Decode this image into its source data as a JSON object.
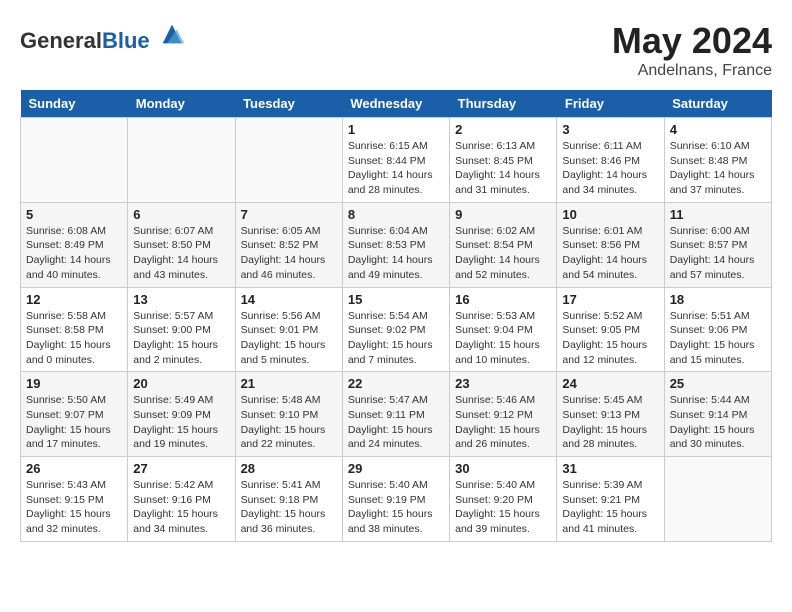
{
  "header": {
    "logo_general": "General",
    "logo_blue": "Blue",
    "month_year": "May 2024",
    "location": "Andelnans, France"
  },
  "weekdays": [
    "Sunday",
    "Monday",
    "Tuesday",
    "Wednesday",
    "Thursday",
    "Friday",
    "Saturday"
  ],
  "weeks": [
    [
      {
        "day": "",
        "sunrise": "",
        "sunset": "",
        "daylight": ""
      },
      {
        "day": "",
        "sunrise": "",
        "sunset": "",
        "daylight": ""
      },
      {
        "day": "",
        "sunrise": "",
        "sunset": "",
        "daylight": ""
      },
      {
        "day": "1",
        "sunrise": "Sunrise: 6:15 AM",
        "sunset": "Sunset: 8:44 PM",
        "daylight": "Daylight: 14 hours and 28 minutes."
      },
      {
        "day": "2",
        "sunrise": "Sunrise: 6:13 AM",
        "sunset": "Sunset: 8:45 PM",
        "daylight": "Daylight: 14 hours and 31 minutes."
      },
      {
        "day": "3",
        "sunrise": "Sunrise: 6:11 AM",
        "sunset": "Sunset: 8:46 PM",
        "daylight": "Daylight: 14 hours and 34 minutes."
      },
      {
        "day": "4",
        "sunrise": "Sunrise: 6:10 AM",
        "sunset": "Sunset: 8:48 PM",
        "daylight": "Daylight: 14 hours and 37 minutes."
      }
    ],
    [
      {
        "day": "5",
        "sunrise": "Sunrise: 6:08 AM",
        "sunset": "Sunset: 8:49 PM",
        "daylight": "Daylight: 14 hours and 40 minutes."
      },
      {
        "day": "6",
        "sunrise": "Sunrise: 6:07 AM",
        "sunset": "Sunset: 8:50 PM",
        "daylight": "Daylight: 14 hours and 43 minutes."
      },
      {
        "day": "7",
        "sunrise": "Sunrise: 6:05 AM",
        "sunset": "Sunset: 8:52 PM",
        "daylight": "Daylight: 14 hours and 46 minutes."
      },
      {
        "day": "8",
        "sunrise": "Sunrise: 6:04 AM",
        "sunset": "Sunset: 8:53 PM",
        "daylight": "Daylight: 14 hours and 49 minutes."
      },
      {
        "day": "9",
        "sunrise": "Sunrise: 6:02 AM",
        "sunset": "Sunset: 8:54 PM",
        "daylight": "Daylight: 14 hours and 52 minutes."
      },
      {
        "day": "10",
        "sunrise": "Sunrise: 6:01 AM",
        "sunset": "Sunset: 8:56 PM",
        "daylight": "Daylight: 14 hours and 54 minutes."
      },
      {
        "day": "11",
        "sunrise": "Sunrise: 6:00 AM",
        "sunset": "Sunset: 8:57 PM",
        "daylight": "Daylight: 14 hours and 57 minutes."
      }
    ],
    [
      {
        "day": "12",
        "sunrise": "Sunrise: 5:58 AM",
        "sunset": "Sunset: 8:58 PM",
        "daylight": "Daylight: 15 hours and 0 minutes."
      },
      {
        "day": "13",
        "sunrise": "Sunrise: 5:57 AM",
        "sunset": "Sunset: 9:00 PM",
        "daylight": "Daylight: 15 hours and 2 minutes."
      },
      {
        "day": "14",
        "sunrise": "Sunrise: 5:56 AM",
        "sunset": "Sunset: 9:01 PM",
        "daylight": "Daylight: 15 hours and 5 minutes."
      },
      {
        "day": "15",
        "sunrise": "Sunrise: 5:54 AM",
        "sunset": "Sunset: 9:02 PM",
        "daylight": "Daylight: 15 hours and 7 minutes."
      },
      {
        "day": "16",
        "sunrise": "Sunrise: 5:53 AM",
        "sunset": "Sunset: 9:04 PM",
        "daylight": "Daylight: 15 hours and 10 minutes."
      },
      {
        "day": "17",
        "sunrise": "Sunrise: 5:52 AM",
        "sunset": "Sunset: 9:05 PM",
        "daylight": "Daylight: 15 hours and 12 minutes."
      },
      {
        "day": "18",
        "sunrise": "Sunrise: 5:51 AM",
        "sunset": "Sunset: 9:06 PM",
        "daylight": "Daylight: 15 hours and 15 minutes."
      }
    ],
    [
      {
        "day": "19",
        "sunrise": "Sunrise: 5:50 AM",
        "sunset": "Sunset: 9:07 PM",
        "daylight": "Daylight: 15 hours and 17 minutes."
      },
      {
        "day": "20",
        "sunrise": "Sunrise: 5:49 AM",
        "sunset": "Sunset: 9:09 PM",
        "daylight": "Daylight: 15 hours and 19 minutes."
      },
      {
        "day": "21",
        "sunrise": "Sunrise: 5:48 AM",
        "sunset": "Sunset: 9:10 PM",
        "daylight": "Daylight: 15 hours and 22 minutes."
      },
      {
        "day": "22",
        "sunrise": "Sunrise: 5:47 AM",
        "sunset": "Sunset: 9:11 PM",
        "daylight": "Daylight: 15 hours and 24 minutes."
      },
      {
        "day": "23",
        "sunrise": "Sunrise: 5:46 AM",
        "sunset": "Sunset: 9:12 PM",
        "daylight": "Daylight: 15 hours and 26 minutes."
      },
      {
        "day": "24",
        "sunrise": "Sunrise: 5:45 AM",
        "sunset": "Sunset: 9:13 PM",
        "daylight": "Daylight: 15 hours and 28 minutes."
      },
      {
        "day": "25",
        "sunrise": "Sunrise: 5:44 AM",
        "sunset": "Sunset: 9:14 PM",
        "daylight": "Daylight: 15 hours and 30 minutes."
      }
    ],
    [
      {
        "day": "26",
        "sunrise": "Sunrise: 5:43 AM",
        "sunset": "Sunset: 9:15 PM",
        "daylight": "Daylight: 15 hours and 32 minutes."
      },
      {
        "day": "27",
        "sunrise": "Sunrise: 5:42 AM",
        "sunset": "Sunset: 9:16 PM",
        "daylight": "Daylight: 15 hours and 34 minutes."
      },
      {
        "day": "28",
        "sunrise": "Sunrise: 5:41 AM",
        "sunset": "Sunset: 9:18 PM",
        "daylight": "Daylight: 15 hours and 36 minutes."
      },
      {
        "day": "29",
        "sunrise": "Sunrise: 5:40 AM",
        "sunset": "Sunset: 9:19 PM",
        "daylight": "Daylight: 15 hours and 38 minutes."
      },
      {
        "day": "30",
        "sunrise": "Sunrise: 5:40 AM",
        "sunset": "Sunset: 9:20 PM",
        "daylight": "Daylight: 15 hours and 39 minutes."
      },
      {
        "day": "31",
        "sunrise": "Sunrise: 5:39 AM",
        "sunset": "Sunset: 9:21 PM",
        "daylight": "Daylight: 15 hours and 41 minutes."
      },
      {
        "day": "",
        "sunrise": "",
        "sunset": "",
        "daylight": ""
      }
    ]
  ]
}
